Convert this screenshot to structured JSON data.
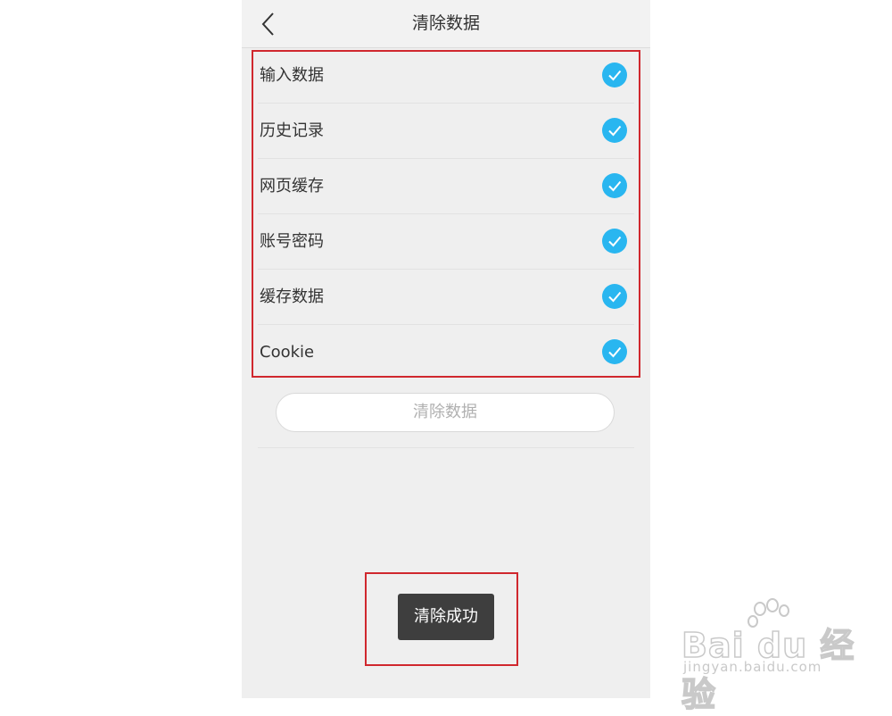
{
  "header": {
    "title": "清除数据",
    "back_icon": "chevron-left-icon"
  },
  "options": [
    {
      "label": "输入数据",
      "checked": true
    },
    {
      "label": "历史记录",
      "checked": true
    },
    {
      "label": "网页缓存",
      "checked": true
    },
    {
      "label": "账号密码",
      "checked": true
    },
    {
      "label": "缓存数据",
      "checked": true
    },
    {
      "label": "Cookie",
      "checked": true
    }
  ],
  "actions": {
    "clear_label": "清除数据"
  },
  "toast": {
    "message": "清除成功"
  },
  "watermark": {
    "logo": "Bai du 经验",
    "url": "jingyan.baidu.com"
  },
  "colors": {
    "accent": "#29b6f0",
    "highlight_box": "#d0282e",
    "toast_bg": "#3e3e3e"
  }
}
